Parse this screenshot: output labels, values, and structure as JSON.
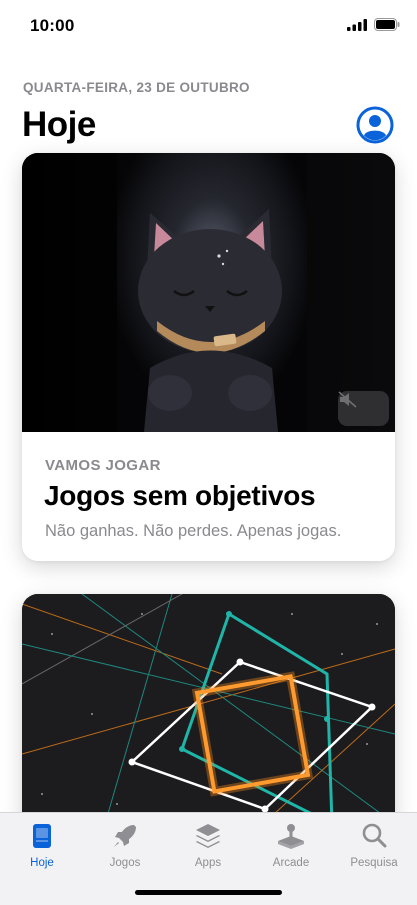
{
  "status_bar": {
    "time": "10:00",
    "signal_icon": "cellular-signal-icon",
    "battery_icon": "battery-icon"
  },
  "header": {
    "date": "QUARTA-FEIRA, 23 DE OUTUBRO",
    "title": "Hoje",
    "account_icon": "account-icon"
  },
  "featured_card": {
    "eyebrow": "VAMOS JOGAR",
    "title": "Jogos sem objetivos",
    "subtitle": "Não ganhas. Não perdes. Apenas jogas.",
    "mute_icon": "speaker-muted-icon"
  },
  "second_card": {
    "artwork": "geometric-neon-artwork"
  },
  "tab_bar": {
    "items": [
      {
        "label": "Hoje",
        "icon": "today-icon",
        "active": true
      },
      {
        "label": "Jogos",
        "icon": "rocket-icon",
        "active": false
      },
      {
        "label": "Apps",
        "icon": "apps-stack-icon",
        "active": false
      },
      {
        "label": "Arcade",
        "icon": "joystick-icon",
        "active": false
      },
      {
        "label": "Pesquisa",
        "icon": "search-icon",
        "active": false
      }
    ]
  },
  "colors": {
    "accent": "#0a63d9",
    "secondary_text": "#8a8a8e",
    "tab_inactive": "#8e8e93",
    "neon_orange": "#ff8c1a",
    "neon_teal": "#1fb5a8"
  }
}
